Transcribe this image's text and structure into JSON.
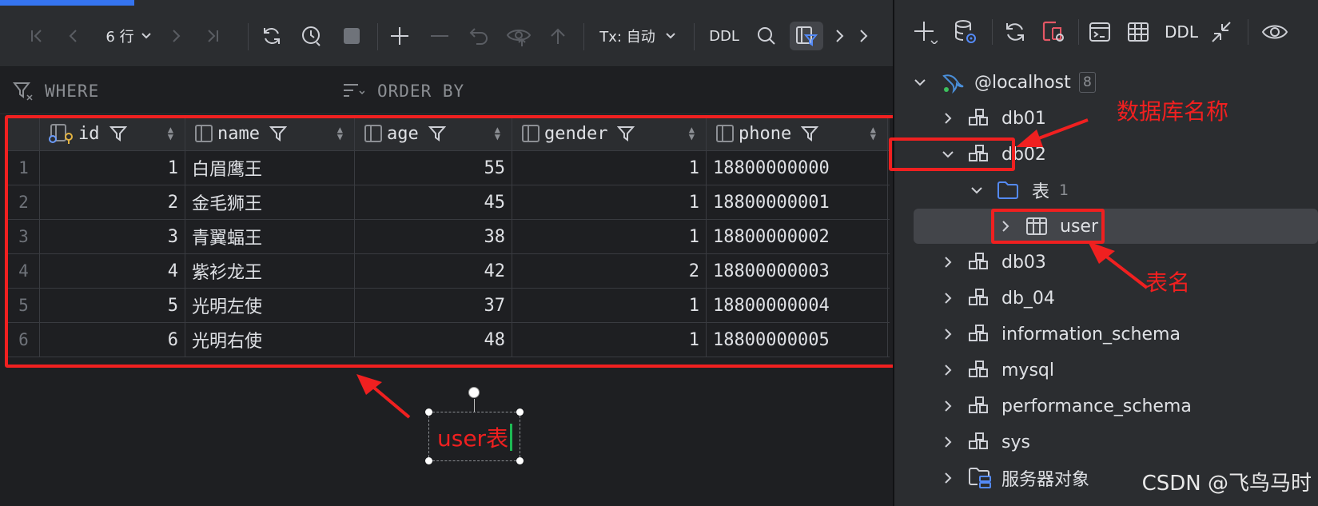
{
  "toolbar": {
    "rows_label": "6 行",
    "tx_label": "Tx: 自动",
    "ddl_label": "DDL"
  },
  "filter": {
    "where_label": "WHERE",
    "orderby_label": "ORDER BY"
  },
  "table": {
    "columns": [
      "id",
      "name",
      "age",
      "gender",
      "phone"
    ],
    "rows": [
      {
        "num": "1",
        "id": "1",
        "name": "白眉鹰王",
        "age": "55",
        "gender": "1",
        "phone": "18800000000"
      },
      {
        "num": "2",
        "id": "2",
        "name": "金毛狮王",
        "age": "45",
        "gender": "1",
        "phone": "18800000001"
      },
      {
        "num": "3",
        "id": "3",
        "name": "青翼蝠王",
        "age": "38",
        "gender": "1",
        "phone": "18800000002"
      },
      {
        "num": "4",
        "id": "4",
        "name": "紫衫龙王",
        "age": "42",
        "gender": "2",
        "phone": "18800000003"
      },
      {
        "num": "5",
        "id": "5",
        "name": "光明左使",
        "age": "37",
        "gender": "1",
        "phone": "18800000004"
      },
      {
        "num": "6",
        "id": "6",
        "name": "光明右使",
        "age": "48",
        "gender": "1",
        "phone": "18800000005"
      }
    ]
  },
  "annotations": {
    "table_note": "user表",
    "db_note": "数据库名称",
    "tablename_note": "表名",
    "color": "#f02020"
  },
  "right_toolbar": {
    "ddl_label": "DDL"
  },
  "tree": {
    "connection": "@localhost",
    "connection_count": "8",
    "databases": [
      "db01",
      "db02",
      "db03",
      "db_04",
      "information_schema",
      "mysql",
      "performance_schema",
      "sys"
    ],
    "tables_folder": "表",
    "tables_count": "1",
    "table": "user",
    "server_objects": "服务器对象"
  },
  "watermark": "CSDN @飞鸟马时",
  "colors": {
    "accent": "#3574f0",
    "background": "#1e1f22",
    "panel": "#2b2d30"
  }
}
